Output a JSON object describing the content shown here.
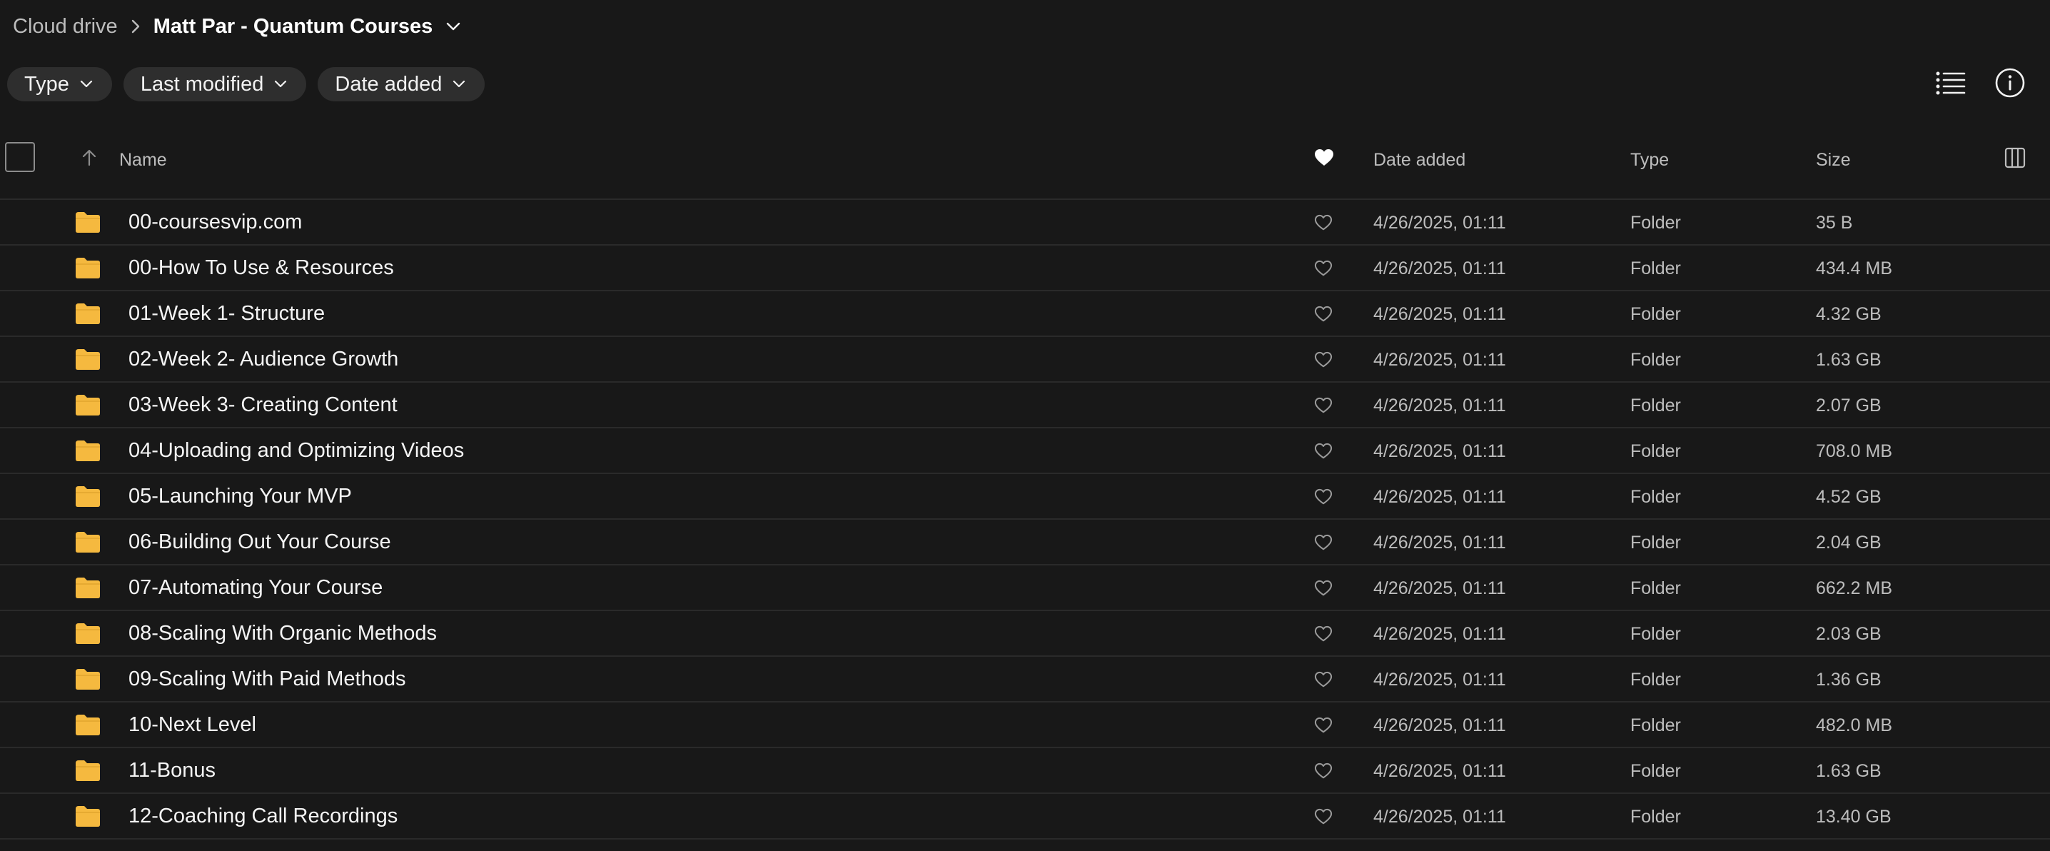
{
  "breadcrumb": {
    "root": "Cloud drive",
    "current": "Matt Par - Quantum Courses"
  },
  "filters": [
    {
      "label": "Type"
    },
    {
      "label": "Last modified"
    },
    {
      "label": "Date added"
    }
  ],
  "toolbar": {
    "view_icon": "list-view-icon",
    "info_icon": "info-icon"
  },
  "columns": {
    "name": "Name",
    "date_added": "Date added",
    "type": "Type",
    "size": "Size"
  },
  "colors": {
    "background": "#181818",
    "folder": "#f5b93f",
    "chip": "#2e2e2e",
    "divider": "#2a2a2a"
  },
  "rows": [
    {
      "name": "00-coursesvip.com",
      "date": "4/26/2025, 01:11",
      "type": "Folder",
      "size": "35 B"
    },
    {
      "name": "00-How To Use & Resources",
      "date": "4/26/2025, 01:11",
      "type": "Folder",
      "size": "434.4 MB"
    },
    {
      "name": "01-Week 1- Structure",
      "date": "4/26/2025, 01:11",
      "type": "Folder",
      "size": "4.32 GB"
    },
    {
      "name": "02-Week 2- Audience Growth",
      "date": "4/26/2025, 01:11",
      "type": "Folder",
      "size": "1.63 GB"
    },
    {
      "name": "03-Week 3- Creating Content",
      "date": "4/26/2025, 01:11",
      "type": "Folder",
      "size": "2.07 GB"
    },
    {
      "name": "04-Uploading and Optimizing Videos",
      "date": "4/26/2025, 01:11",
      "type": "Folder",
      "size": "708.0 MB"
    },
    {
      "name": "05-Launching Your MVP",
      "date": "4/26/2025, 01:11",
      "type": "Folder",
      "size": "4.52 GB"
    },
    {
      "name": "06-Building Out Your Course",
      "date": "4/26/2025, 01:11",
      "type": "Folder",
      "size": "2.04 GB"
    },
    {
      "name": "07-Automating Your Course",
      "date": "4/26/2025, 01:11",
      "type": "Folder",
      "size": "662.2 MB"
    },
    {
      "name": "08-Scaling With Organic Methods",
      "date": "4/26/2025, 01:11",
      "type": "Folder",
      "size": "2.03 GB"
    },
    {
      "name": "09-Scaling With Paid Methods",
      "date": "4/26/2025, 01:11",
      "type": "Folder",
      "size": "1.36 GB"
    },
    {
      "name": "10-Next Level",
      "date": "4/26/2025, 01:11",
      "type": "Folder",
      "size": "482.0 MB"
    },
    {
      "name": "11-Bonus",
      "date": "4/26/2025, 01:11",
      "type": "Folder",
      "size": "1.63 GB"
    },
    {
      "name": "12-Coaching Call Recordings",
      "date": "4/26/2025, 01:11",
      "type": "Folder",
      "size": "13.40 GB"
    }
  ]
}
